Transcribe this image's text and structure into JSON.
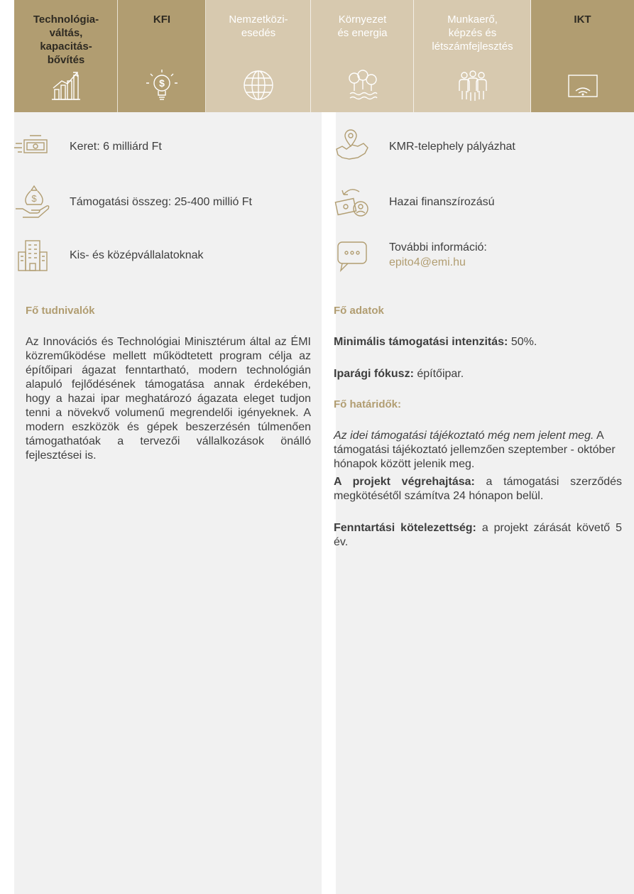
{
  "tabs": [
    {
      "label": "Technológia-\nváltás,\nkapacitás-\nbővítés",
      "active": true,
      "icon": "chart-growth-icon"
    },
    {
      "label": "KFI",
      "active": true,
      "icon": "lightbulb-money-icon"
    },
    {
      "label": "Nemzetközi-\nesedés",
      "active": false,
      "icon": "globe-icon"
    },
    {
      "label": "Környezet\nés energia",
      "active": false,
      "icon": "trees-water-icon"
    },
    {
      "label": "Munkaerő,\nképzés és\nlétszámfejlesztés",
      "active": false,
      "icon": "people-group-icon"
    },
    {
      "label": "IKT",
      "active": true,
      "icon": "wifi-screen-icon"
    }
  ],
  "info": {
    "budget": "Keret: 6 milliárd Ft",
    "amount": "Támogatási összeg: 25-400 millió Ft",
    "target": "Kis- és középvállalatoknak",
    "location": "KMR-telephely pályázhat",
    "funding": "Hazai finanszírozású",
    "more_label": "További információ:",
    "more_email": "epito4@emi.hu"
  },
  "left": {
    "heading": "Fő tudnivalók",
    "body": "Az Innovációs és Technológiai Minisztérum által az ÉMI közreműködése mellett működtetett program célja az építőipari ágazat fenntartható, modern technológián alapuló fejlődésének támogatása annak érdekében, hogy a hazai ipar meghatározó ágazata eleget tudjon tenni a növekvő volumenű megrendelői igényeknek. A modern eszközök és gépek beszerzésén túlmenően támogathatóak a tervezői vállalkozások önálló fejlesztései is."
  },
  "right": {
    "heading": "Fő adatok",
    "min_label": "Minimális támogatási intenzitás:",
    "min_value": " 50%.",
    "focus_label": "Iparági fókusz:",
    "focus_value": " építőipar.",
    "deadlines_heading": "Fő határidők:",
    "deadlines_italic": "Az idei támogatási tájékoztató még nem jelent meg.",
    "deadlines_text": "A támogatási tájékoztató jellemzően szeptember - október hónapok között jelenik meg.",
    "exec_label": "A projekt végrehajtása:",
    "exec_value": " a támogatási szerződés megkötésétől számítva 24 hónapon belül.",
    "sustain_label": "Fenntartási kötelezettség:",
    "sustain_value": " a projekt zárását követő 5 év."
  },
  "colors": {
    "gold": "#b19d71",
    "light_gold": "#d7c9af",
    "panel": "#f1f1f1",
    "text": "#3e3e3e"
  }
}
